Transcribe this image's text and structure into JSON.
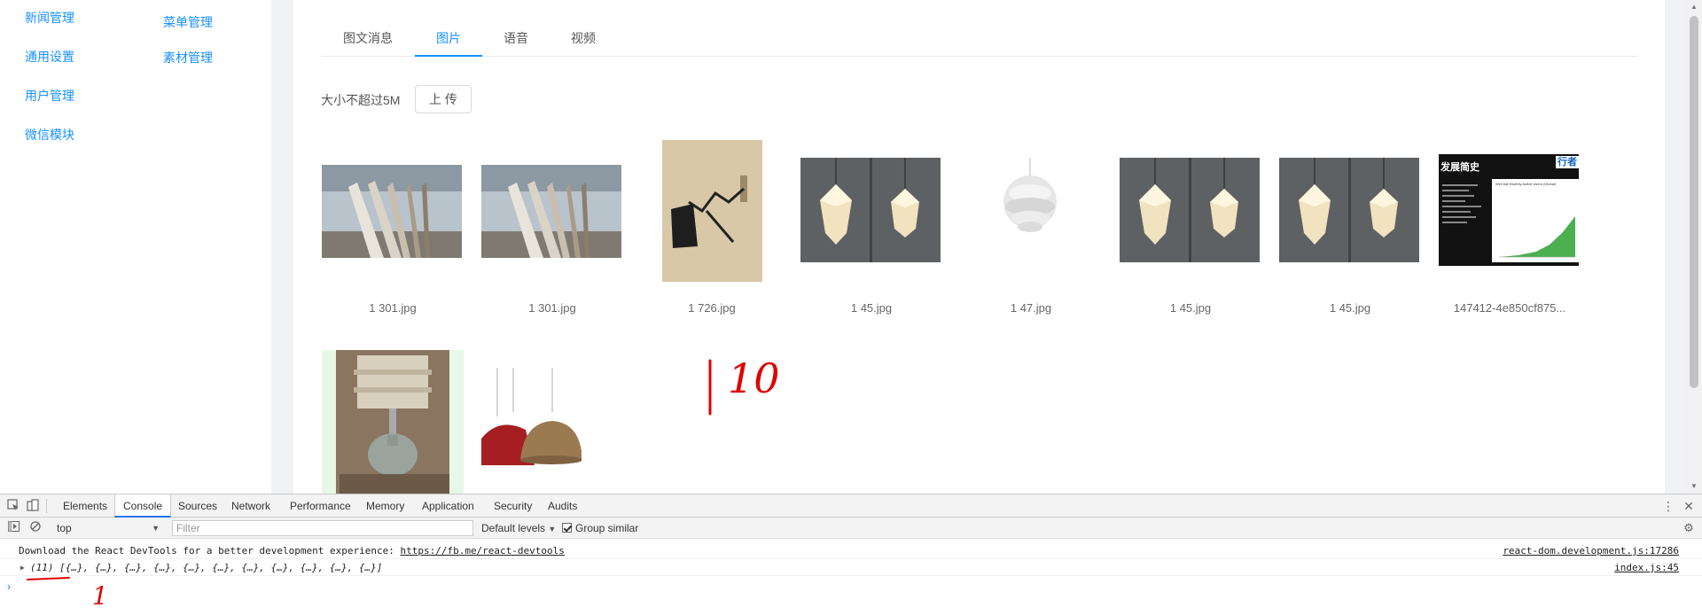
{
  "sidebar": {
    "left_items": [
      {
        "label": "新闻管理"
      },
      {
        "label": "通用设置"
      },
      {
        "label": "用户管理"
      },
      {
        "label": "微信模块"
      }
    ],
    "right_items": [
      {
        "label": "菜单管理"
      },
      {
        "label": "素材管理"
      }
    ]
  },
  "tabs": [
    {
      "label": "图文消息",
      "active": false
    },
    {
      "label": "图片",
      "active": true
    },
    {
      "label": "语音",
      "active": false
    },
    {
      "label": "视频",
      "active": false
    }
  ],
  "upload": {
    "hint": "大小不超过5M",
    "button_label": "上 传"
  },
  "images": [
    {
      "name": "1 301.jpg",
      "depicts": "architecture-photo"
    },
    {
      "name": "1 301.jpg",
      "depicts": "architecture-photo"
    },
    {
      "name": "1 726.jpg",
      "depicts": "wall-lamp-photo"
    },
    {
      "name": "1 45.jpg",
      "depicts": "pendant-lamps-photo"
    },
    {
      "name": "1 47.jpg",
      "depicts": "white-pendant-photo"
    },
    {
      "name": "1 45.jpg",
      "depicts": "pendant-lamps-photo"
    },
    {
      "name": "1 45.jpg",
      "depicts": "pendant-lamps-photo"
    },
    {
      "name": "147412-4e850cf875...",
      "depicts": "chart-slide-image"
    },
    {
      "name": "",
      "depicts": "table-lamp-photo"
    },
    {
      "name": "",
      "depicts": "red-pendant-lamps-photo"
    }
  ],
  "thumb_texts": {
    "slide_title": "发展简史",
    "slide_corner": "行者",
    "slide_chart_title": "WeChat Monthly Active Users (Global)"
  },
  "annotations": {
    "count_mark": "10",
    "console_mark": "1"
  },
  "colors": {
    "accent": "#1890ff",
    "annotation": "#e00000"
  },
  "devtools": {
    "tabs": [
      "Elements",
      "Console",
      "Sources",
      "Network",
      "Performance",
      "Memory",
      "Application",
      "Security",
      "Audits"
    ],
    "active_tab": "Console",
    "context": "top",
    "filter_placeholder": "Filter",
    "levels": "Default levels",
    "group_similar": "Group similar",
    "group_similar_checked": true,
    "messages": [
      {
        "text": "Download the React DevTools for a better development experience: ",
        "link": "https://fb.me/react-devtools",
        "source": "react-dom.development.js:17286"
      },
      {
        "text": "(11) [{…}, {…}, {…}, {…}, {…}, {…}, {…}, {…}, {…}, {…}, {…}]",
        "source": "index.js:45"
      }
    ]
  }
}
